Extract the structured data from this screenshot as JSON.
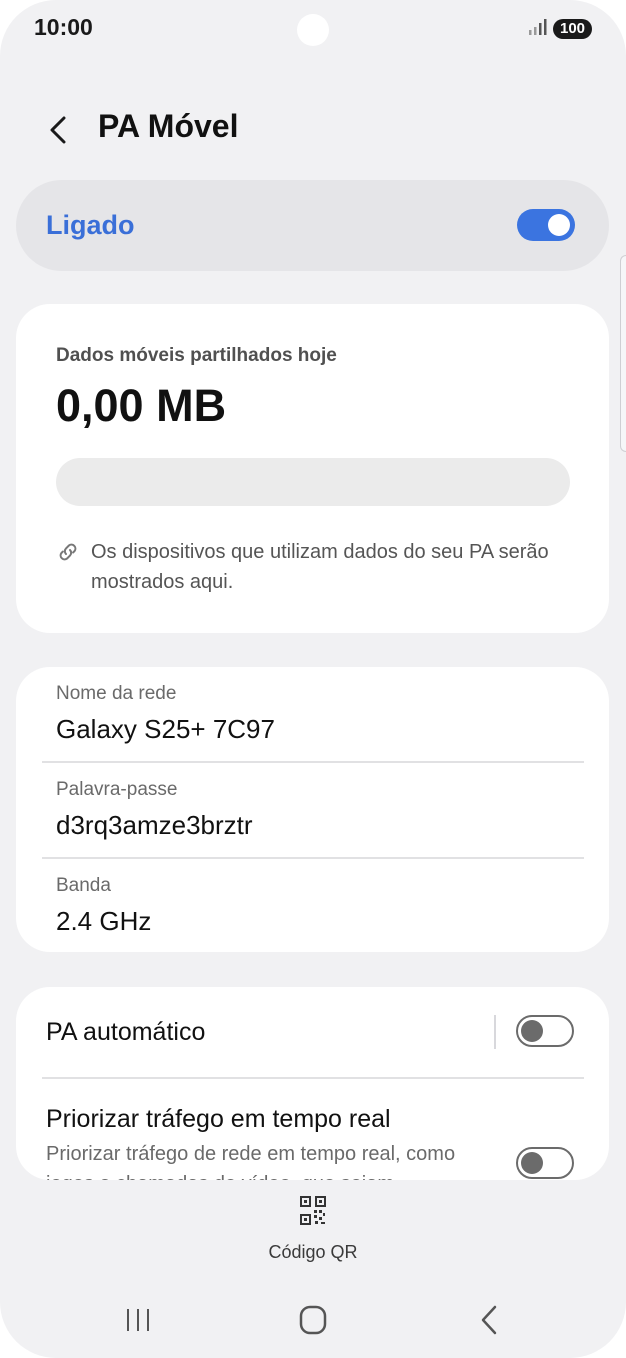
{
  "status_bar": {
    "time": "10:00",
    "battery": "100"
  },
  "header": {
    "title": "PA Móvel"
  },
  "main_toggle": {
    "label": "Ligado",
    "state": "on"
  },
  "usage": {
    "label": "Dados móveis partilhados hoje",
    "value": "0,00 MB",
    "progress_fraction": 0,
    "info": "Os dispositivos que utilizam dados do seu PA serão mostrados aqui."
  },
  "network": {
    "name_label": "Nome da rede",
    "name_value": "Galaxy S25+ 7C97",
    "password_label": "Palavra-passe",
    "password_value": "d3rq3amze3brztr",
    "band_label": "Banda",
    "band_value": "2.4 GHz"
  },
  "settings": {
    "auto_hotspot_label": "PA automático",
    "auto_hotspot_state": "off",
    "priority_title": "Priorizar tráfego em tempo real",
    "priority_subtitle": "Priorizar tráfego de rede em tempo real, como jogos e chamadas de vídeo, que sejam",
    "priority_state": "off"
  },
  "qr": {
    "label": "Código QR"
  },
  "colors": {
    "accent": "#3b74e0",
    "background": "#f1f1f3",
    "card": "#ffffff"
  }
}
